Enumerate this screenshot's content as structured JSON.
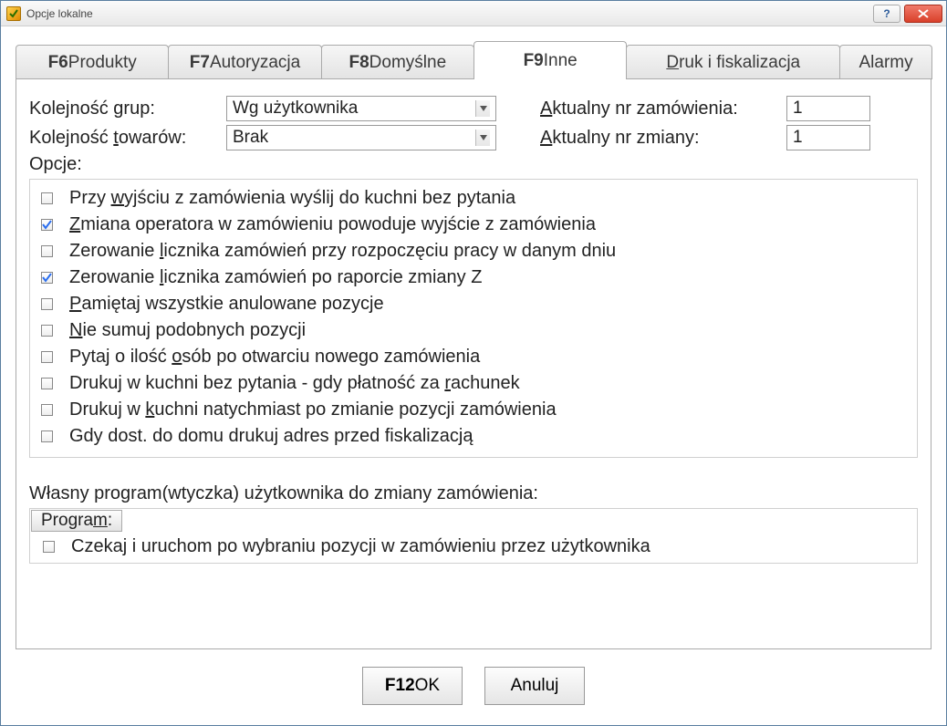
{
  "window": {
    "title": "Opcje lokalne"
  },
  "tabs": {
    "t0_b": "F6",
    "t0_r": " Produkty",
    "t1_b": "F7",
    "t1_r": " Autoryzacja",
    "t2_b": "F8",
    "t2_r": " Domyślne",
    "t3_b": "F9",
    "t3_r": " Inne",
    "t4_u": "D",
    "t4_r": "ruk i fiskalizacja",
    "t5": "Alarmy"
  },
  "form": {
    "group_order_label_pre": "Kolejność ",
    "group_order_label_u": "g",
    "group_order_label_post": "rup:",
    "group_order_value": "Wg użytkownika",
    "prod_order_label_pre": "Kolejność ",
    "prod_order_label_u": "t",
    "prod_order_label_post": "owarów:",
    "prod_order_value": "Brak",
    "order_no_label_u": "A",
    "order_no_label_post": "ktualny nr zamówienia:",
    "order_no_value": "1",
    "shift_no_label_u": "A",
    "shift_no_label_post": "ktualny nr zmiany:",
    "shift_no_value": "1",
    "opcje_label": "Opcje:"
  },
  "options": [
    {
      "checked": false,
      "pre": "Przy ",
      "u": "w",
      "post": "yjściu z zamówienia wyślij do kuchni bez pytania"
    },
    {
      "checked": true,
      "pre": "",
      "u": "Z",
      "post": "miana operatora w zamówieniu powoduje wyjście z zamówienia"
    },
    {
      "checked": false,
      "pre": "Zerowanie ",
      "u": "l",
      "post": "icznika zamówień przy rozpoczęciu pracy w danym dniu"
    },
    {
      "checked": true,
      "pre": "Zerowanie ",
      "u": "l",
      "post": "icznika zamówień po raporcie zmiany Z"
    },
    {
      "checked": false,
      "pre": "",
      "u": "P",
      "post": "amiętaj wszystkie anulowane pozycje"
    },
    {
      "checked": false,
      "pre": "",
      "u": "N",
      "post": "ie sumuj podobnych pozycji"
    },
    {
      "checked": false,
      "pre": "Pytaj o ilość ",
      "u": "o",
      "post": "sób po otwarciu nowego zamówienia"
    },
    {
      "checked": false,
      "pre": "Drukuj w kuchni bez pytania - gdy płatność za ",
      "u": "r",
      "post": "achunek"
    },
    {
      "checked": false,
      "pre": "Drukuj w ",
      "u": "k",
      "post": "uchni natychmiast po zmianie pozycji zamówienia"
    },
    {
      "checked": false,
      "pre": "Gdy dost. do domu drukuj adres przed fiskalizacją",
      "u": "",
      "post": ""
    }
  ],
  "plugin": {
    "label": "Własny program(wtyczka) użytkownika do zmiany zamówienia:",
    "button_pre": "Progra",
    "button_u": "m",
    "button_post": ":",
    "checkbox": "Czekaj i uruchom po wybraniu pozycji w zamówieniu przez użytkownika",
    "checkbox_checked": false
  },
  "footer": {
    "ok_b": "F12",
    "ok_r": " OK",
    "cancel": "Anuluj"
  }
}
